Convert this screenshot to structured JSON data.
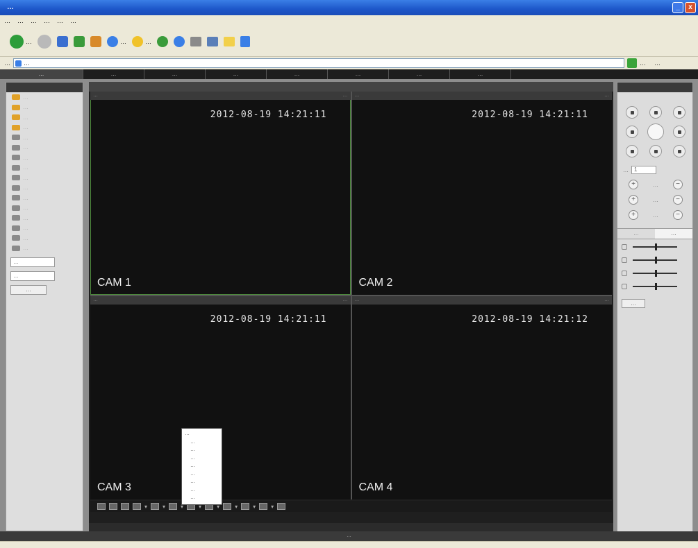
{
  "window": {
    "title": "…",
    "minimize": "_",
    "close": "x"
  },
  "menu": [
    "…",
    "…",
    "…",
    "…",
    "…",
    "…"
  ],
  "toolbar": [
    {
      "label": "…",
      "icon": "back-icon"
    },
    {
      "label": "",
      "icon": "forward-icon"
    },
    {
      "label": "…",
      "icon": "search-icon"
    },
    {
      "label": "…",
      "icon": "favorites-icon"
    }
  ],
  "address": {
    "label": "…",
    "value": "…",
    "go": "…",
    "links": "…"
  },
  "nav": [
    "…",
    "…",
    "…",
    "…",
    "…",
    "…",
    "…",
    "…"
  ],
  "left_panel": {
    "cameras": [
      {
        "label": "…",
        "icon": "camera-icon-active"
      },
      {
        "label": "…",
        "icon": "camera-icon-active"
      },
      {
        "label": "…",
        "icon": "camera-icon-active"
      },
      {
        "label": "…",
        "icon": "camera-icon-active"
      },
      {
        "label": "…",
        "icon": "camera-icon"
      },
      {
        "label": "…",
        "icon": "camera-icon"
      },
      {
        "label": "…",
        "icon": "camera-icon"
      },
      {
        "label": "…",
        "icon": "camera-icon"
      },
      {
        "label": "…",
        "icon": "camera-icon"
      },
      {
        "label": "…",
        "icon": "camera-icon"
      },
      {
        "label": "…",
        "icon": "camera-icon"
      },
      {
        "label": "…",
        "icon": "camera-icon"
      },
      {
        "label": "…",
        "icon": "camera-icon"
      },
      {
        "label": "…",
        "icon": "camera-icon"
      },
      {
        "label": "…",
        "icon": "camera-icon"
      },
      {
        "label": "…",
        "icon": "camera-icon"
      }
    ],
    "select1": "…",
    "select2": "…",
    "button": "…"
  },
  "cams": [
    {
      "timestamp": "2012-08-19 14:21:11",
      "name": "CAM 1",
      "bar_left": "…",
      "bar_right": "…"
    },
    {
      "timestamp": "2012-08-19 14:21:11",
      "name": "CAM 2",
      "bar_left": "…",
      "bar_right": "…"
    },
    {
      "timestamp": "2012-08-19 14:21:11",
      "name": "CAM 3",
      "bar_left": "…",
      "bar_right": "…"
    },
    {
      "timestamp": "2012-08-19 14:21:12",
      "name": "CAM 4",
      "bar_left": "…",
      "bar_right": "…"
    }
  ],
  "dropdown": {
    "options": [
      "…",
      "…",
      "…",
      "…",
      "…",
      "…",
      "…",
      "…",
      "…"
    ]
  },
  "right_panel": {
    "speed_label": "…",
    "speed_value": "1",
    "zoom": "…",
    "focus": "…",
    "iris": "…",
    "tabs": [
      "…",
      "…"
    ],
    "reset": "…"
  },
  "copyright": "…"
}
